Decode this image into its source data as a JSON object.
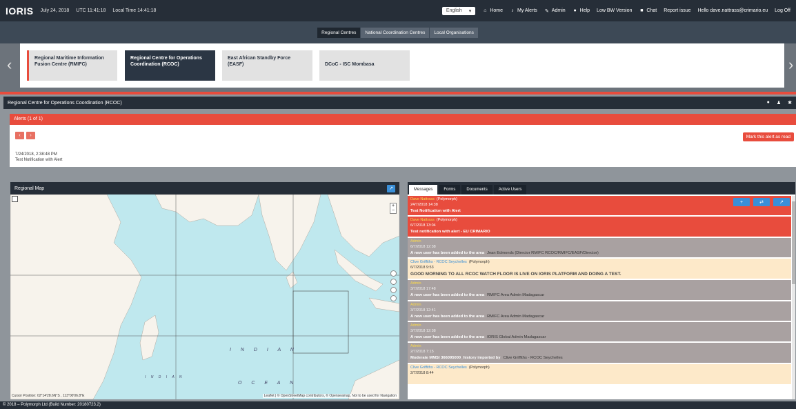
{
  "header": {
    "logo": "IORIS",
    "date": "July 24, 2018",
    "utc_time": "UTC 11:41:18",
    "local_time": "Local Time 14:41:18",
    "language": "English",
    "nav": {
      "home": "Home",
      "alerts": "My Alerts",
      "admin": "Admin",
      "help": "Help",
      "low_bw": "Low BW Version",
      "chat": "Chat",
      "report": "Report issue",
      "user": "Hello dave.nattrass@crimario.eu",
      "logout": "Log Off"
    }
  },
  "segment_tabs": [
    "Regional Centres",
    "National Coordination Centres",
    "Local Organisations"
  ],
  "centres": [
    {
      "label": "Regional Maritime Information Fusion Centre (RMIFC)"
    },
    {
      "label": "Regional Centre for Operations Coordination (RCOC)"
    },
    {
      "label": "East African Standby Force (EASF)"
    },
    {
      "label": "DCoC - ISC Mombasa"
    }
  ],
  "panel": {
    "title": "Regional Centre for Operations Coordination (RCOC)"
  },
  "alerts": {
    "title": "Alerts (1 of 1)",
    "mark_read": "Mark this alert as read",
    "timestamp": "7/24/2018, 2:38:48 PM",
    "text": "Test Notification with Alert"
  },
  "map": {
    "title": "Regional Map",
    "zoom_in": "+",
    "zoom_out": "−",
    "cursor": "Cursor Position: 02°14'28.6N°S , 113°00'06.8°E",
    "attribution": "Leaflet | © OpenStreetMap contributors, © Openseamap, Not to be used for Navigation",
    "ocean_label_1": "I N D I A N",
    "ocean_label_2": "O C E A N",
    "sea_label": "I N D I A N"
  },
  "messages": {
    "tabs": [
      "Messages",
      "Forms",
      "Documents",
      "Active Users"
    ],
    "items": [
      {
        "style": "red",
        "sender": "Dave Nattrass",
        "org": "(Polymorph)",
        "date": "24/7/2018 14:38",
        "body": "Test Notification with Alert",
        "tail": ""
      },
      {
        "style": "red",
        "sender": "Dave Nattrass",
        "org": "(Polymorph)",
        "date": "6/7/2018 13:04",
        "body": "Test notification with alert - EU CRIMARIO",
        "tail": ""
      },
      {
        "style": "gray",
        "sender": "Admin",
        "org": "",
        "date": "6/7/2018 12:38",
        "body": "A new user has been added to the area",
        "tail": "Jean Edmonds (Director RMIFC RCOC/RMIFC/EASF/Director)"
      },
      {
        "style": "cream",
        "sender": "Clive Griffiths - RCOC Seychelles",
        "org": "(Polymorph)",
        "date": "6/7/2018 9:53",
        "body": "GOOD MORNING TO ALL RCOC WATCH FLOOR IS LIVE ON IORIS PLATFORM AND DOING A TEST.",
        "tail": ""
      },
      {
        "style": "gray",
        "sender": "Admin",
        "org": "",
        "date": "3/7/2018 17:48",
        "body": "A new user has been added to the area",
        "tail": "RMIFC Area Admin Madagascar"
      },
      {
        "style": "gray",
        "sender": "Admin",
        "org": "",
        "date": "3/7/2018 12:41",
        "body": "A new user has been added to the area",
        "tail": "RMIFC Area Admin Madagascar"
      },
      {
        "style": "gray",
        "sender": "Admin",
        "org": "",
        "date": "3/7/2018 12:38",
        "body": "A new user has been added to the area",
        "tail": "IORIS Global Admin Madagascar"
      },
      {
        "style": "gray",
        "sender": "Admin",
        "org": "",
        "date": "2/7/2018 7:15",
        "body": "Moderate MMSI 366095000_history imported by",
        "tail": "Clive Griffiths - RCOC Seychelles"
      },
      {
        "style": "cream",
        "sender": "Clive Griffiths - RCOC Seychelles",
        "org": "(Polymorph)",
        "date": "2/7/2018 8:44",
        "body": "",
        "tail": ""
      }
    ],
    "actions": [
      "+",
      "⇄",
      "↗"
    ]
  },
  "footer": "© 2018 – Polymorph Ltd (Build Number: 20180723.2)",
  "colors": {
    "accent_red": "#e84c3d",
    "dark": "#262e38",
    "blue": "#3a8fd8"
  }
}
